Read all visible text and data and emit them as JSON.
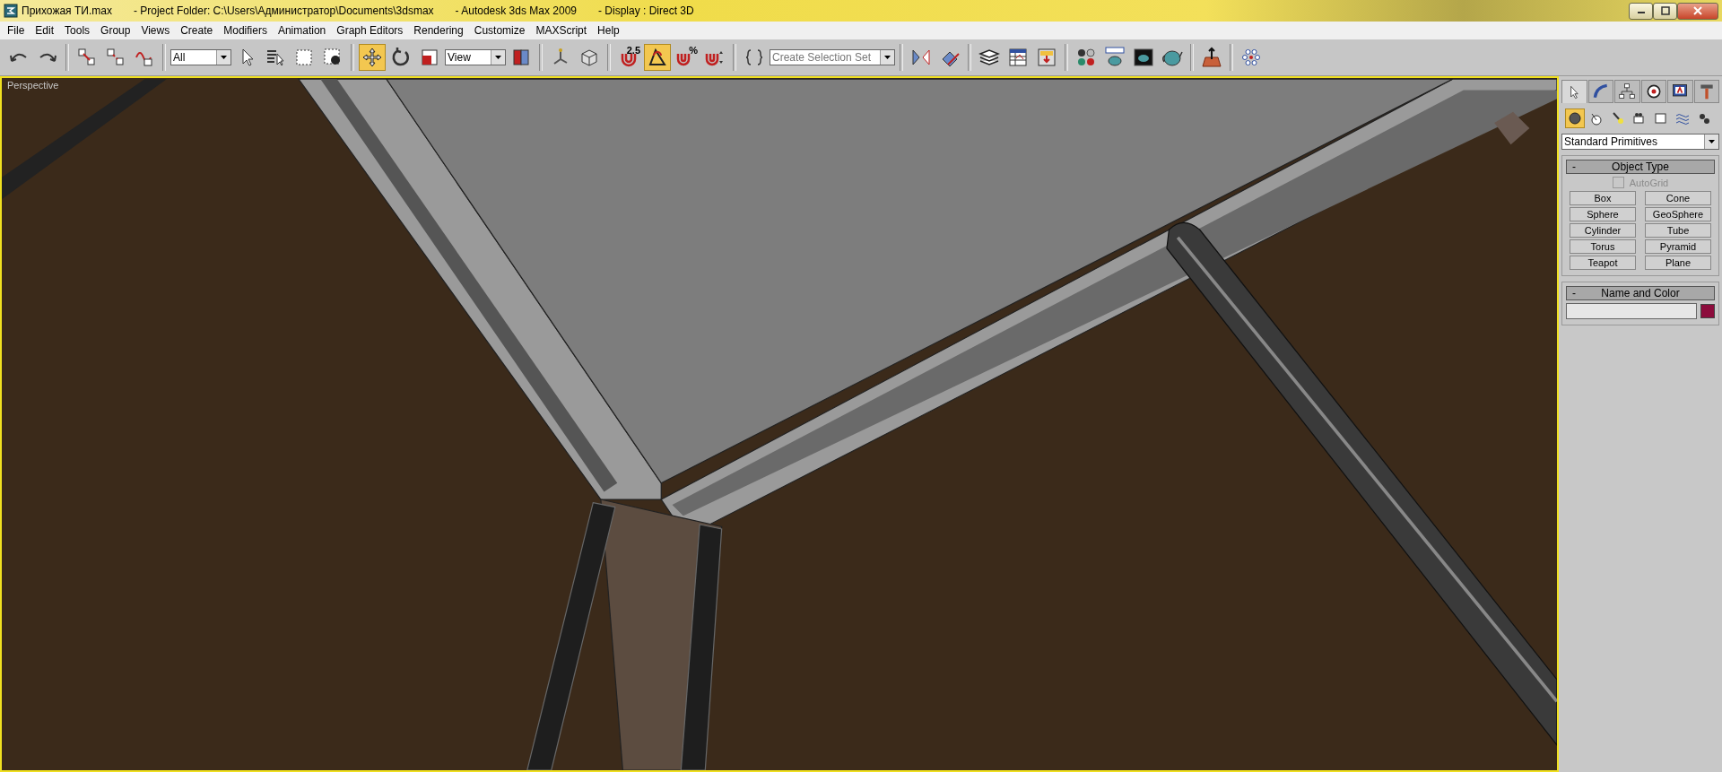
{
  "window": {
    "title_parts": [
      "Прихожая ТИ.max",
      "- Project Folder: C:\\Users\\Администратор\\Documents\\3dsmax",
      "- Autodesk 3ds Max  2009",
      "- Display : Direct 3D"
    ]
  },
  "menu": [
    "File",
    "Edit",
    "Tools",
    "Group",
    "Views",
    "Create",
    "Modifiers",
    "Animation",
    "Graph Editors",
    "Rendering",
    "Customize",
    "MAXScript",
    "Help"
  ],
  "toolbar": [
    {
      "kind": "icon",
      "selected": false
    },
    {
      "kind": "icon",
      "selected": false
    },
    {
      "kind": "separator"
    },
    {
      "kind": "icon",
      "selected": false
    },
    {
      "kind": "icon",
      "selected": false
    },
    {
      "kind": "icon",
      "selected": false
    },
    {
      "kind": "separator"
    },
    {
      "kind": "dropdown",
      "value": "All"
    },
    {
      "kind": "icon",
      "selected": false
    },
    {
      "kind": "icon",
      "selected": false
    },
    {
      "kind": "icon",
      "selected": false
    },
    {
      "kind": "icon",
      "selected": false
    },
    {
      "kind": "separator"
    },
    {
      "kind": "icon",
      "selected": true
    },
    {
      "kind": "icon",
      "selected": false
    },
    {
      "kind": "icon",
      "selected": false
    },
    {
      "kind": "dropdown",
      "value": "View"
    },
    {
      "kind": "icon",
      "selected": false
    },
    {
      "kind": "separator"
    },
    {
      "kind": "icon",
      "selected": false
    },
    {
      "kind": "icon",
      "selected": false
    },
    {
      "kind": "separator"
    },
    {
      "kind": "icon",
      "selected": false,
      "label": "2.5"
    },
    {
      "kind": "icon",
      "selected": true
    },
    {
      "kind": "icon",
      "selected": false,
      "label": "%"
    },
    {
      "kind": "icon",
      "selected": false
    },
    {
      "kind": "separator"
    },
    {
      "kind": "icon",
      "selected": false
    },
    {
      "kind": "dropdown",
      "placeholder": "Create Selection Set"
    },
    {
      "kind": "separator"
    },
    {
      "kind": "icon",
      "selected": false
    },
    {
      "kind": "icon",
      "selected": false
    },
    {
      "kind": "separator"
    },
    {
      "kind": "icon",
      "selected": false
    },
    {
      "kind": "icon",
      "selected": false
    },
    {
      "kind": "icon",
      "selected": false
    },
    {
      "kind": "separator"
    },
    {
      "kind": "icon",
      "selected": false
    },
    {
      "kind": "icon",
      "selected": false
    },
    {
      "kind": "icon",
      "selected": false
    },
    {
      "kind": "icon",
      "selected": false
    },
    {
      "kind": "separator"
    },
    {
      "kind": "icon",
      "selected": false
    },
    {
      "kind": "separator"
    },
    {
      "kind": "icon",
      "selected": false
    }
  ],
  "viewport": {
    "label": "Perspective",
    "active": true
  },
  "command_panel": {
    "tabs": [
      {
        "selected": true
      },
      {
        "selected": false
      },
      {
        "selected": false
      },
      {
        "selected": false
      },
      {
        "selected": false
      },
      {
        "selected": false
      }
    ],
    "categories": [
      {
        "selected": true
      },
      {
        "selected": false
      },
      {
        "selected": false
      },
      {
        "selected": false
      },
      {
        "selected": false
      },
      {
        "selected": false
      },
      {
        "selected": false
      }
    ],
    "type_dropdown": "Standard Primitives",
    "object_type": {
      "title": "Object Type",
      "collapse": "-",
      "autogrid": {
        "label": "AutoGrid",
        "checked": false,
        "disabled": true
      },
      "buttons": [
        "Box",
        "Cone",
        "Sphere",
        "GeoSphere",
        "Cylinder",
        "Tube",
        "Torus",
        "Pyramid",
        "Teapot",
        "Plane"
      ]
    },
    "name_and_color": {
      "title": "Name and Color",
      "collapse": "-",
      "color": "#8c0c3c"
    }
  }
}
